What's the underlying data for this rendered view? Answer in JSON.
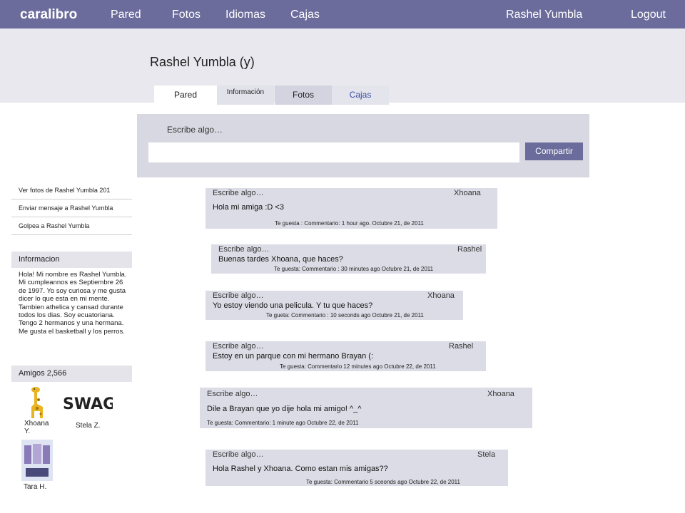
{
  "topbar": {
    "logo": "caralibro",
    "nav": [
      "Pared",
      "Fotos",
      "Idiomas",
      "Cajas"
    ],
    "user": "Rashel Yumbla",
    "logout": "Logout"
  },
  "profile": {
    "title": "Rashel Yumbla (y)"
  },
  "tabs": {
    "pared": "Pared",
    "info": "Información",
    "fotos": "Fotos",
    "cajas": "Cajas"
  },
  "composer": {
    "label": "Escribe algo…",
    "share": "Compartir"
  },
  "side_links": [
    "Ver fotos de Rashel Yumbla 201",
    "Enviar mensaje a Rashel Yumbla",
    "Golpea a Rashel Yumbla"
  ],
  "info": {
    "heading": "Informacion",
    "text": "Hola! Mi nombre es Rashel Yumbla. Mi cumpleannos es Septiembre 26 de 1997. Yo soy curiosa y me gusta dicer lo que esta en mi mente. Tambien athelica y cansad durante todos los dias.  Soy ecuatoriana. Tengo 2 hermanos y una hermana. Me gusta el basketball y los perros."
  },
  "friends": {
    "heading": "Amigos 2,566",
    "list": [
      {
        "name": "Xhoana Y.",
        "icon": "giraffe-icon"
      },
      {
        "name": "Stela Z.",
        "icon": "swag-logo-icon"
      },
      {
        "name": "Tara H.",
        "icon": "poster-icon"
      }
    ]
  },
  "posts": [
    {
      "label": "Escribe algo…",
      "author": "Xhoana",
      "text": "Hola mi amiga :D <3",
      "meta": "Te guesta : Commentario:     1 hour ago.    Octubre 21, de 2011"
    },
    {
      "label": "Escribe algo…",
      "author": "Rashel",
      "text": "Buenas tardes Xhoana, que haces?",
      "meta": "Te guesta: Commentario :   30 minutes ago   Octubre 21, de 2011"
    },
    {
      "label": "Escribe algo…",
      "author": "Xhoana",
      "text": "Yo estoy viendo una pelicula. Y tu que haces?",
      "meta": "Te gueta:  Commentario  : 10 seconds ago   Octubre 21,  de 2011"
    },
    {
      "label": "Escribe algo…",
      "author": "Rashel",
      "text": "Estoy en un parque con mi hermano Brayan (:",
      "meta": "Te guesta:     Commentario   12  minutes ago   Octubre 22, de 2011"
    },
    {
      "label": "Escribe algo…",
      "author": "Xhoana",
      "text": "Dile a Brayan que yo dije hola mi amigo! ^_^",
      "meta": "Te guesta:     Commentario:   1 minute ago        Octubre 22, de 2011"
    },
    {
      "label": "Escribe algo…",
      "author": "Stela",
      "text": "Hola Rashel y Xhoana. Como estan mis amigas??",
      "meta": "Te guesta: Commentario 5 sceonds ago            Octubre 22, de 2011"
    }
  ]
}
